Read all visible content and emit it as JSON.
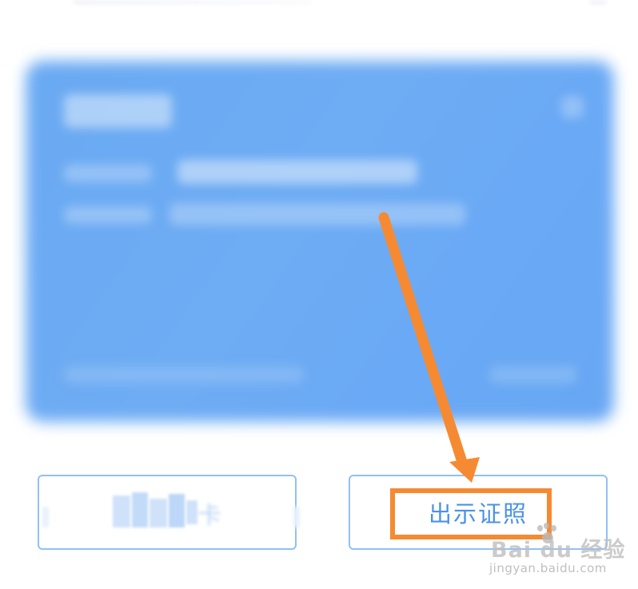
{
  "buttons": {
    "left": {
      "label": ""
    },
    "right": {
      "label": "出示证照"
    }
  },
  "card": {
    "state": "blurred"
  },
  "watermark": {
    "main": "Bai du 经验",
    "sub": "jingyan.baidu.com"
  },
  "colors": {
    "card_blue": "#6aaaf2",
    "button_border": "#8fc1f7",
    "button_text": "#4a92e6",
    "annotation_orange": "#f68a32"
  },
  "icons": {
    "annotation": "arrow-pointer-icon",
    "watermark": "baidu-paw-icon"
  }
}
